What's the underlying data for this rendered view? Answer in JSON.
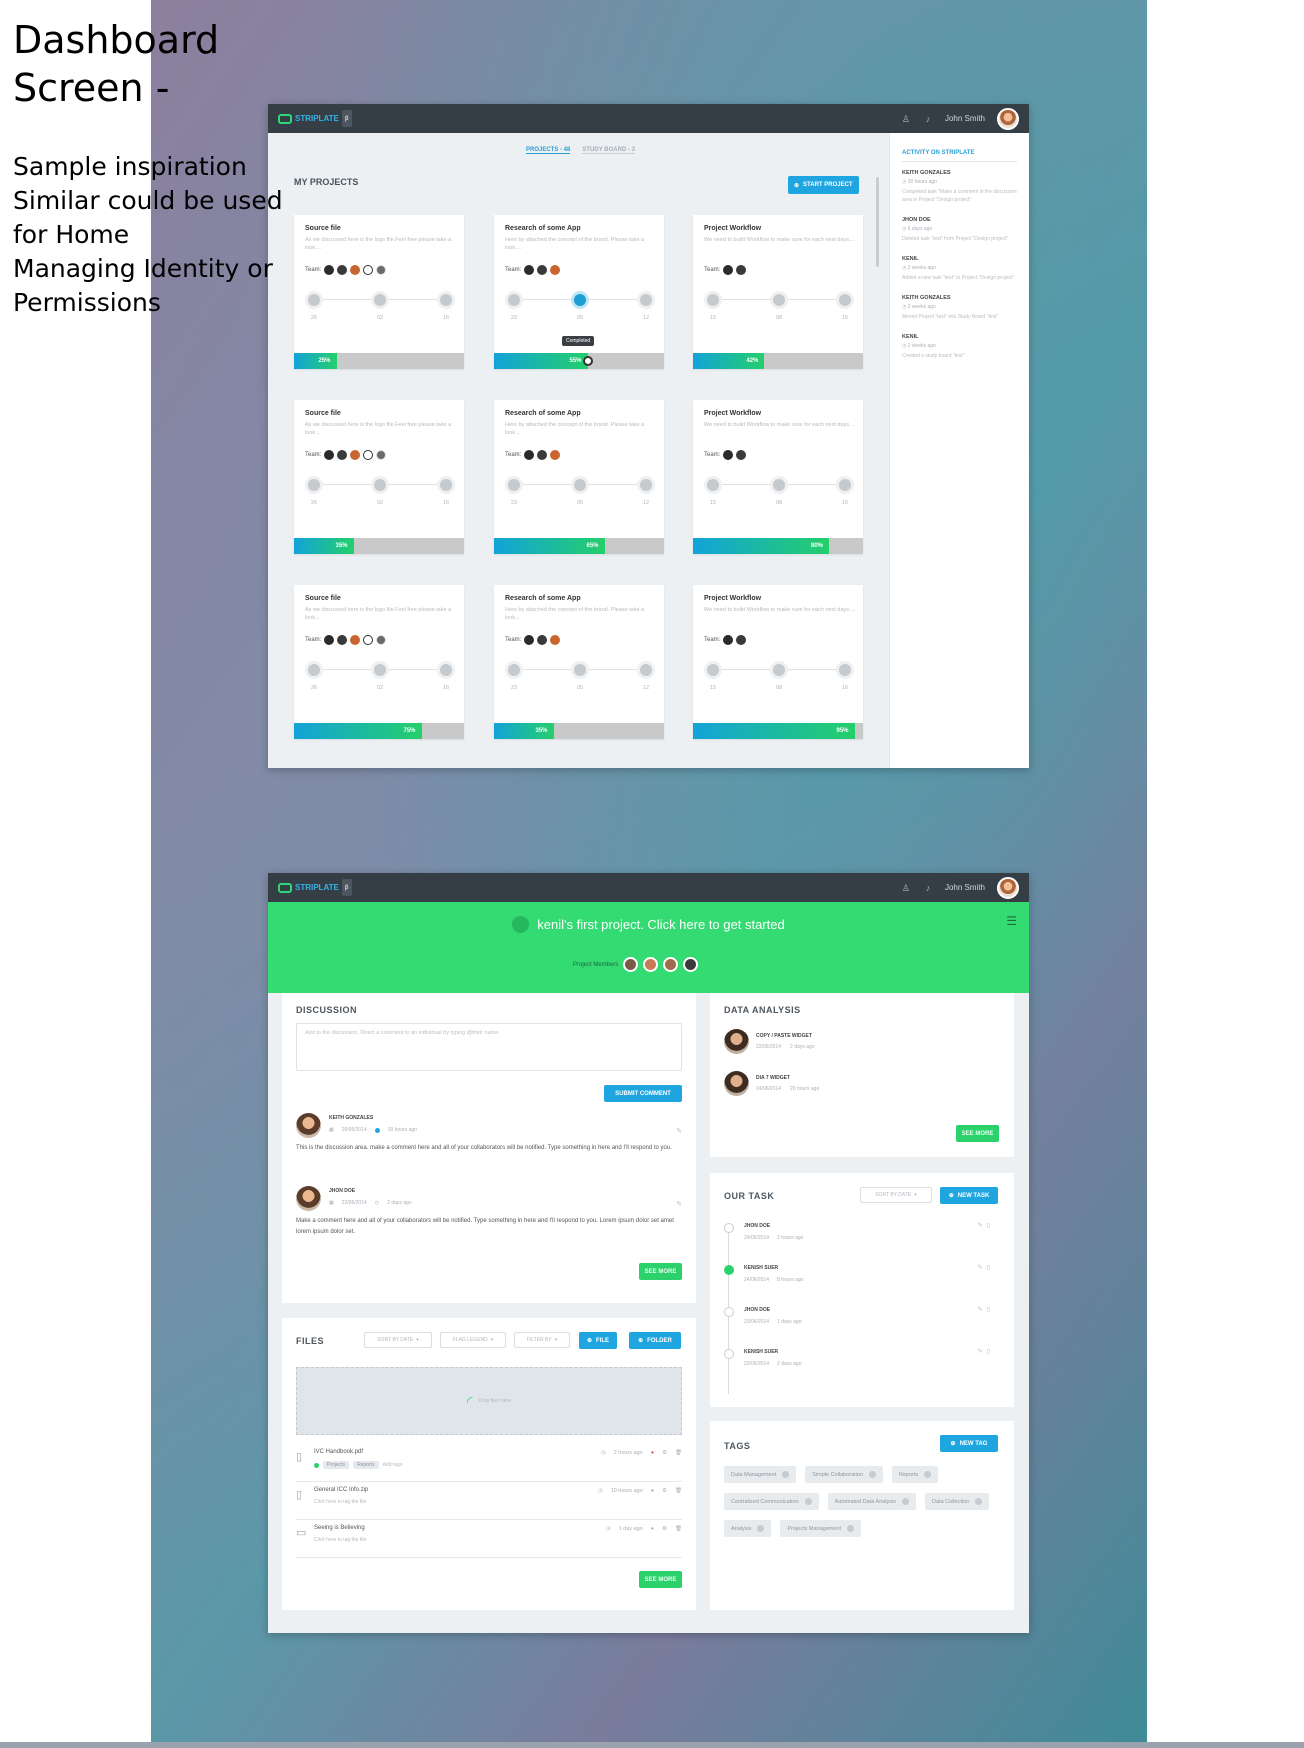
{
  "caption": {
    "title_lines": [
      "Dashboard",
      "Screen  -"
    ],
    "body_lines": [
      "Sample inspiration",
      "Similar could be used",
      "for Home",
      "Managing Identity or",
      "Permissions"
    ]
  },
  "app": {
    "brand": "STRIPLATE",
    "brand_tag": "β",
    "user_name": "John Smith"
  },
  "projects_screen": {
    "tabs": [
      "PROJECTS - 48",
      "STUDY BOARD - 3"
    ],
    "heading": "MY PROJECTS",
    "start_project_label": "START PROJECT",
    "team_label": "Team:",
    "tooltip": "Completed",
    "cards": [
      {
        "title": "Source file",
        "desc": "As we discussed here is the logo file.Feel free please take a look....",
        "team": 5,
        "counts": [
          "26",
          "02",
          "16"
        ],
        "progress": 25,
        "active_step": -1
      },
      {
        "title": "Research of some App",
        "desc": "Here by attached the concept of the brand. Please take a look....",
        "team": 3,
        "counts": [
          "23",
          "05",
          "12"
        ],
        "progress": 55,
        "active_step": 1
      },
      {
        "title": "Project Workflow",
        "desc": "We need to build Workflow to make sure for each next days....",
        "team": 2,
        "counts": [
          "15",
          "08",
          "16"
        ],
        "progress": 42,
        "active_step": -1
      },
      {
        "title": "Source file",
        "desc": "As we discussed here is the logo file.Feel free please take a look....",
        "team": 5,
        "counts": [
          "26",
          "02",
          "16"
        ],
        "progress": 35,
        "active_step": -1
      },
      {
        "title": "Research of some App",
        "desc": "Here by attached the concept of the brand. Please take a look....",
        "team": 3,
        "counts": [
          "23",
          "05",
          "12"
        ],
        "progress": 65,
        "active_step": -1
      },
      {
        "title": "Project Workflow",
        "desc": "We need to build Workflow to make sure for each next days....",
        "team": 2,
        "counts": [
          "15",
          "08",
          "16"
        ],
        "progress": 80,
        "active_step": -1
      },
      {
        "title": "Source file",
        "desc": "As we discussed here is the logo file.Feel free please take a look....",
        "team": 5,
        "counts": [
          "26",
          "02",
          "16"
        ],
        "progress": 75,
        "active_step": -1
      },
      {
        "title": "Research of some App",
        "desc": "Here by attached the concept of the brand. Please take a look....",
        "team": 3,
        "counts": [
          "23",
          "05",
          "12"
        ],
        "progress": 35,
        "active_step": -1
      },
      {
        "title": "Project Workflow",
        "desc": "We need to build Workflow to make sure for each next days....",
        "team": 2,
        "counts": [
          "15",
          "08",
          "16"
        ],
        "progress": 95,
        "active_step": -1
      }
    ],
    "activity_title": "ACTIVITY ON STRIPLATE",
    "activity": [
      {
        "name": "KEITH GONZALES",
        "time": "20 hours ago",
        "text": "Completed task \"Make a comment in the discussion area in Project \"Design project\""
      },
      {
        "name": "JHON DOE",
        "time": "6 days ago",
        "text": "Deleted task \"test\" from Project \"Design project\""
      },
      {
        "name": "KENIL",
        "time": "2 weeks ago",
        "text": "Added a new task \"test\" to Project \"Design project\""
      },
      {
        "name": "KEITH GONZALES",
        "time": "2 weeks ago",
        "text": "Moved Project \"test\" into Study Board \"test\""
      },
      {
        "name": "KENIL",
        "time": "2 weeks ago",
        "text": "Created a study board \"test\""
      }
    ]
  },
  "project_screen": {
    "hero_title": "kenil's first project. Click here to get started",
    "members_label": "Project Members",
    "discussion": {
      "title": "DISCUSSION",
      "placeholder": "Add to the discussion, Direct a comment to an individual by typing @their name.",
      "submit_label": "SUBMIT COMMENT",
      "see_more": "SEE MORE",
      "comments": [
        {
          "name": "KEITH GONZALES",
          "date": "26/06/2014",
          "time": "20 hours ago",
          "text": "This is the discussion area. make a comment here and all of your collaborators will be notified. Type something in here and I'll respond to you."
        },
        {
          "name": "JHON DOE",
          "date": "22/06/2014",
          "time": "2 days ago",
          "text": "Make a comment here and all of your collaborators will be notified. Type something in here and I'll respond to you. Lorem ipsum dolor set amet lorem ipsum dolor set."
        }
      ]
    },
    "files": {
      "title": "FILES",
      "sort_label": "SORT BY DATE",
      "flag_label": "FLAG LEGEND",
      "filter_label": "FILTER BY",
      "file_btn": "FILE",
      "folder_btn": "FOLDER",
      "drop_label": "Drop files here",
      "see_more": "SEE MORE",
      "items": [
        {
          "name": "IVC Handbook.pdf",
          "sub": "Add tags",
          "time": "2 hours ago",
          "tags": [
            "Projects",
            "Reports"
          ]
        },
        {
          "name": "General ICC Info.zip",
          "sub": "Click here to tag the file",
          "time": "10 hours ago",
          "tags": []
        },
        {
          "name": "Seeing is Believing",
          "sub": "Click here to tag the file",
          "time": "1 day ago",
          "tags": []
        }
      ]
    },
    "data_analysis": {
      "title": "DATA ANALYSIS",
      "see_more": "SEE MORE",
      "items": [
        {
          "name": "COPY / PASTE WIDGET",
          "date": "22/06/2014",
          "time": "2 days ago"
        },
        {
          "name": "DIA 7 WIDGET",
          "date": "24/06/2014",
          "time": "20 hours ago"
        }
      ]
    },
    "tasks": {
      "title": "OUR TASK",
      "sort_label": "SORT BY DATE",
      "new_label": "NEW TASK",
      "items": [
        {
          "name": "JHON DOE",
          "date": "24/06/2014",
          "time": "2 hours ago",
          "done": false
        },
        {
          "name": "KENISH SUER",
          "date": "24/06/2014",
          "time": "8 hours ago",
          "done": true
        },
        {
          "name": "JHON DOE",
          "date": "23/06/2014",
          "time": "1 days ago",
          "done": false
        },
        {
          "name": "KENISH SUER",
          "date": "22/06/2014",
          "time": "2 days ago",
          "done": false
        }
      ]
    },
    "tags": {
      "title": "TAGS",
      "new_label": "NEW TAG",
      "items": [
        "Data Management",
        "Simple Collaboration",
        "Reports",
        "Centralized Communication",
        "Automated Data Analysis",
        "Data Collection",
        "Analysis",
        "Projects Management"
      ]
    }
  },
  "colors": {
    "accent_blue": "#1fa6e0",
    "accent_green": "#2bd26b",
    "hero_green": "#34da72",
    "topbar": "#363e45"
  }
}
